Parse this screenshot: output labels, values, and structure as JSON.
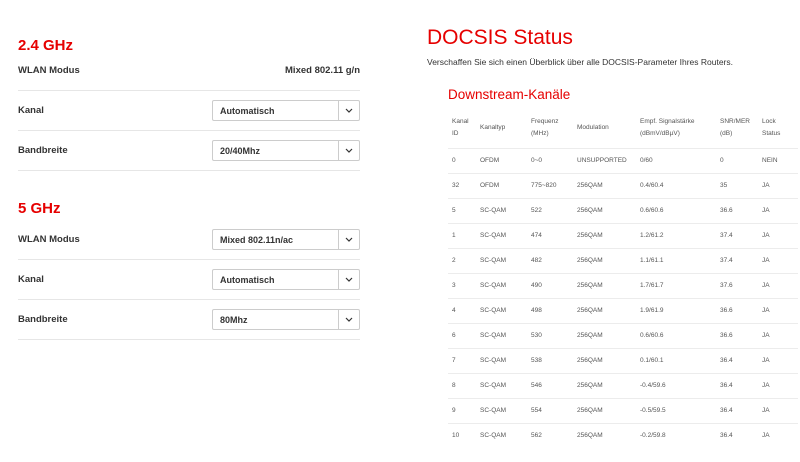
{
  "wlan": {
    "band_24": {
      "title": "2.4 GHz",
      "mode_label": "WLAN Modus",
      "mode_value": "Mixed 802.11 g/n",
      "channel_label": "Kanal",
      "channel_value": "Automatisch",
      "bandwidth_label": "Bandbreite",
      "bandwidth_value": "20/40Mhz"
    },
    "band_5": {
      "title": "5 GHz",
      "mode_label": "WLAN Modus",
      "mode_value": "Mixed 802.11n/ac",
      "channel_label": "Kanal",
      "channel_value": "Automatisch",
      "bandwidth_label": "Bandbreite",
      "bandwidth_value": "80Mhz"
    }
  },
  "docsis": {
    "title": "DOCSIS Status",
    "intro": "Verschaffen Sie sich einen Überblick über alle DOCSIS-Parameter Ihres Routers.",
    "downstream_title": "Downstream-Kanäle",
    "columns": [
      [
        "Kanal",
        "ID"
      ],
      [
        "Kanaltyp"
      ],
      [
        "Frequenz",
        "(MHz)"
      ],
      [
        "Modulation"
      ],
      [
        "Empf. Signalstärke",
        "(dBmV/dBµV)"
      ],
      [
        "SNR/MER",
        "(dB)"
      ],
      [
        "Lock",
        "Status"
      ]
    ],
    "rows": [
      [
        "0",
        "OFDM",
        "0~0",
        "UNSUPPORTED",
        "0/60",
        "0",
        "NEIN"
      ],
      [
        "32",
        "OFDM",
        "775~820",
        "256QAM",
        "0.4/60.4",
        "35",
        "JA"
      ],
      [
        "5",
        "SC-QAM",
        "522",
        "256QAM",
        "0.6/60.6",
        "36.6",
        "JA"
      ],
      [
        "1",
        "SC-QAM",
        "474",
        "256QAM",
        "1.2/61.2",
        "37.4",
        "JA"
      ],
      [
        "2",
        "SC-QAM",
        "482",
        "256QAM",
        "1.1/61.1",
        "37.4",
        "JA"
      ],
      [
        "3",
        "SC-QAM",
        "490",
        "256QAM",
        "1.7/61.7",
        "37.6",
        "JA"
      ],
      [
        "4",
        "SC-QAM",
        "498",
        "256QAM",
        "1.9/61.9",
        "36.6",
        "JA"
      ],
      [
        "6",
        "SC-QAM",
        "530",
        "256QAM",
        "0.6/60.6",
        "36.6",
        "JA"
      ],
      [
        "7",
        "SC-QAM",
        "538",
        "256QAM",
        "0.1/60.1",
        "36.4",
        "JA"
      ],
      [
        "8",
        "SC-QAM",
        "546",
        "256QAM",
        "-0.4/59.6",
        "36.4",
        "JA"
      ],
      [
        "9",
        "SC-QAM",
        "554",
        "256QAM",
        "-0.5/59.5",
        "36.4",
        "JA"
      ],
      [
        "10",
        "SC-QAM",
        "562",
        "256QAM",
        "-0.2/59.8",
        "36.4",
        "JA"
      ]
    ]
  },
  "colors": {
    "accent": "#e60000",
    "divider": "#e6e6e6"
  },
  "icons": {
    "select_arrow": "chevron-down-icon"
  }
}
